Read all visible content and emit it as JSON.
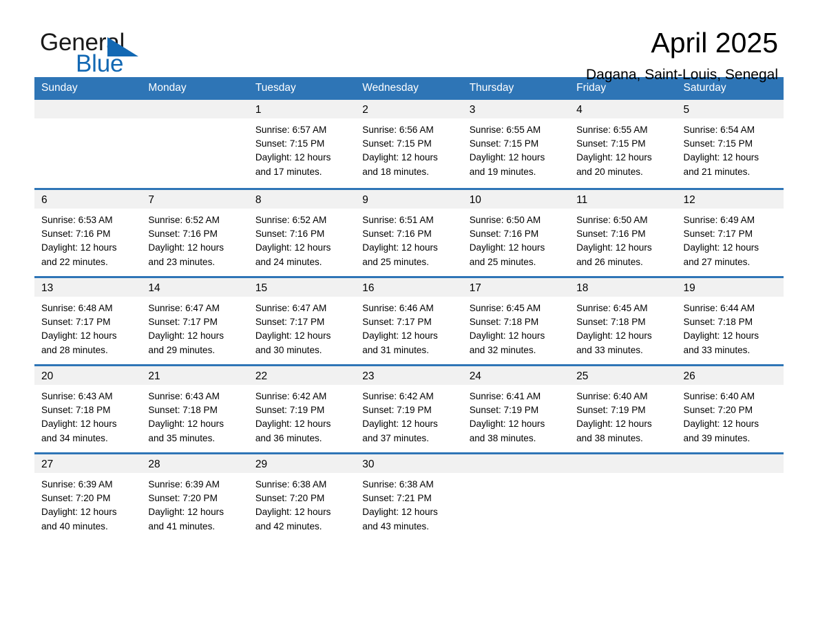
{
  "brand": {
    "name_part1": "General",
    "name_part2": "Blue",
    "triangle_color": "#1268b3",
    "text_color": "#1a1a1a"
  },
  "header": {
    "month_title": "April 2025",
    "location": "Dagana, Saint-Louis, Senegal",
    "header_bg_color": "#2e75b6",
    "header_text_color": "#ffffff",
    "daynum_band_color": "#f1f1f1"
  },
  "weekday_headers": [
    "Sunday",
    "Monday",
    "Tuesday",
    "Wednesday",
    "Thursday",
    "Friday",
    "Saturday"
  ],
  "weeks": [
    {
      "ruled": false,
      "days": [
        {
          "day": "",
          "sunrise": "",
          "sunset": "",
          "daylight_line1": "",
          "daylight_line2": ""
        },
        {
          "day": "",
          "sunrise": "",
          "sunset": "",
          "daylight_line1": "",
          "daylight_line2": ""
        },
        {
          "day": "1",
          "sunrise": "Sunrise: 6:57 AM",
          "sunset": "Sunset: 7:15 PM",
          "daylight_line1": "Daylight: 12 hours",
          "daylight_line2": "and 17 minutes."
        },
        {
          "day": "2",
          "sunrise": "Sunrise: 6:56 AM",
          "sunset": "Sunset: 7:15 PM",
          "daylight_line1": "Daylight: 12 hours",
          "daylight_line2": "and 18 minutes."
        },
        {
          "day": "3",
          "sunrise": "Sunrise: 6:55 AM",
          "sunset": "Sunset: 7:15 PM",
          "daylight_line1": "Daylight: 12 hours",
          "daylight_line2": "and 19 minutes."
        },
        {
          "day": "4",
          "sunrise": "Sunrise: 6:55 AM",
          "sunset": "Sunset: 7:15 PM",
          "daylight_line1": "Daylight: 12 hours",
          "daylight_line2": "and 20 minutes."
        },
        {
          "day": "5",
          "sunrise": "Sunrise: 6:54 AM",
          "sunset": "Sunset: 7:15 PM",
          "daylight_line1": "Daylight: 12 hours",
          "daylight_line2": "and 21 minutes."
        }
      ]
    },
    {
      "ruled": true,
      "days": [
        {
          "day": "6",
          "sunrise": "Sunrise: 6:53 AM",
          "sunset": "Sunset: 7:16 PM",
          "daylight_line1": "Daylight: 12 hours",
          "daylight_line2": "and 22 minutes."
        },
        {
          "day": "7",
          "sunrise": "Sunrise: 6:52 AM",
          "sunset": "Sunset: 7:16 PM",
          "daylight_line1": "Daylight: 12 hours",
          "daylight_line2": "and 23 minutes."
        },
        {
          "day": "8",
          "sunrise": "Sunrise: 6:52 AM",
          "sunset": "Sunset: 7:16 PM",
          "daylight_line1": "Daylight: 12 hours",
          "daylight_line2": "and 24 minutes."
        },
        {
          "day": "9",
          "sunrise": "Sunrise: 6:51 AM",
          "sunset": "Sunset: 7:16 PM",
          "daylight_line1": "Daylight: 12 hours",
          "daylight_line2": "and 25 minutes."
        },
        {
          "day": "10",
          "sunrise": "Sunrise: 6:50 AM",
          "sunset": "Sunset: 7:16 PM",
          "daylight_line1": "Daylight: 12 hours",
          "daylight_line2": "and 25 minutes."
        },
        {
          "day": "11",
          "sunrise": "Sunrise: 6:50 AM",
          "sunset": "Sunset: 7:16 PM",
          "daylight_line1": "Daylight: 12 hours",
          "daylight_line2": "and 26 minutes."
        },
        {
          "day": "12",
          "sunrise": "Sunrise: 6:49 AM",
          "sunset": "Sunset: 7:17 PM",
          "daylight_line1": "Daylight: 12 hours",
          "daylight_line2": "and 27 minutes."
        }
      ]
    },
    {
      "ruled": true,
      "days": [
        {
          "day": "13",
          "sunrise": "Sunrise: 6:48 AM",
          "sunset": "Sunset: 7:17 PM",
          "daylight_line1": "Daylight: 12 hours",
          "daylight_line2": "and 28 minutes."
        },
        {
          "day": "14",
          "sunrise": "Sunrise: 6:47 AM",
          "sunset": "Sunset: 7:17 PM",
          "daylight_line1": "Daylight: 12 hours",
          "daylight_line2": "and 29 minutes."
        },
        {
          "day": "15",
          "sunrise": "Sunrise: 6:47 AM",
          "sunset": "Sunset: 7:17 PM",
          "daylight_line1": "Daylight: 12 hours",
          "daylight_line2": "and 30 minutes."
        },
        {
          "day": "16",
          "sunrise": "Sunrise: 6:46 AM",
          "sunset": "Sunset: 7:17 PM",
          "daylight_line1": "Daylight: 12 hours",
          "daylight_line2": "and 31 minutes."
        },
        {
          "day": "17",
          "sunrise": "Sunrise: 6:45 AM",
          "sunset": "Sunset: 7:18 PM",
          "daylight_line1": "Daylight: 12 hours",
          "daylight_line2": "and 32 minutes."
        },
        {
          "day": "18",
          "sunrise": "Sunrise: 6:45 AM",
          "sunset": "Sunset: 7:18 PM",
          "daylight_line1": "Daylight: 12 hours",
          "daylight_line2": "and 33 minutes."
        },
        {
          "day": "19",
          "sunrise": "Sunrise: 6:44 AM",
          "sunset": "Sunset: 7:18 PM",
          "daylight_line1": "Daylight: 12 hours",
          "daylight_line2": "and 33 minutes."
        }
      ]
    },
    {
      "ruled": true,
      "days": [
        {
          "day": "20",
          "sunrise": "Sunrise: 6:43 AM",
          "sunset": "Sunset: 7:18 PM",
          "daylight_line1": "Daylight: 12 hours",
          "daylight_line2": "and 34 minutes."
        },
        {
          "day": "21",
          "sunrise": "Sunrise: 6:43 AM",
          "sunset": "Sunset: 7:18 PM",
          "daylight_line1": "Daylight: 12 hours",
          "daylight_line2": "and 35 minutes."
        },
        {
          "day": "22",
          "sunrise": "Sunrise: 6:42 AM",
          "sunset": "Sunset: 7:19 PM",
          "daylight_line1": "Daylight: 12 hours",
          "daylight_line2": "and 36 minutes."
        },
        {
          "day": "23",
          "sunrise": "Sunrise: 6:42 AM",
          "sunset": "Sunset: 7:19 PM",
          "daylight_line1": "Daylight: 12 hours",
          "daylight_line2": "and 37 minutes."
        },
        {
          "day": "24",
          "sunrise": "Sunrise: 6:41 AM",
          "sunset": "Sunset: 7:19 PM",
          "daylight_line1": "Daylight: 12 hours",
          "daylight_line2": "and 38 minutes."
        },
        {
          "day": "25",
          "sunrise": "Sunrise: 6:40 AM",
          "sunset": "Sunset: 7:19 PM",
          "daylight_line1": "Daylight: 12 hours",
          "daylight_line2": "and 38 minutes."
        },
        {
          "day": "26",
          "sunrise": "Sunrise: 6:40 AM",
          "sunset": "Sunset: 7:20 PM",
          "daylight_line1": "Daylight: 12 hours",
          "daylight_line2": "and 39 minutes."
        }
      ]
    },
    {
      "ruled": true,
      "days": [
        {
          "day": "27",
          "sunrise": "Sunrise: 6:39 AM",
          "sunset": "Sunset: 7:20 PM",
          "daylight_line1": "Daylight: 12 hours",
          "daylight_line2": "and 40 minutes."
        },
        {
          "day": "28",
          "sunrise": "Sunrise: 6:39 AM",
          "sunset": "Sunset: 7:20 PM",
          "daylight_line1": "Daylight: 12 hours",
          "daylight_line2": "and 41 minutes."
        },
        {
          "day": "29",
          "sunrise": "Sunrise: 6:38 AM",
          "sunset": "Sunset: 7:20 PM",
          "daylight_line1": "Daylight: 12 hours",
          "daylight_line2": "and 42 minutes."
        },
        {
          "day": "30",
          "sunrise": "Sunrise: 6:38 AM",
          "sunset": "Sunset: 7:21 PM",
          "daylight_line1": "Daylight: 12 hours",
          "daylight_line2": "and 43 minutes."
        },
        {
          "day": "",
          "sunrise": "",
          "sunset": "",
          "daylight_line1": "",
          "daylight_line2": ""
        },
        {
          "day": "",
          "sunrise": "",
          "sunset": "",
          "daylight_line1": "",
          "daylight_line2": ""
        },
        {
          "day": "",
          "sunrise": "",
          "sunset": "",
          "daylight_line1": "",
          "daylight_line2": ""
        }
      ]
    }
  ]
}
